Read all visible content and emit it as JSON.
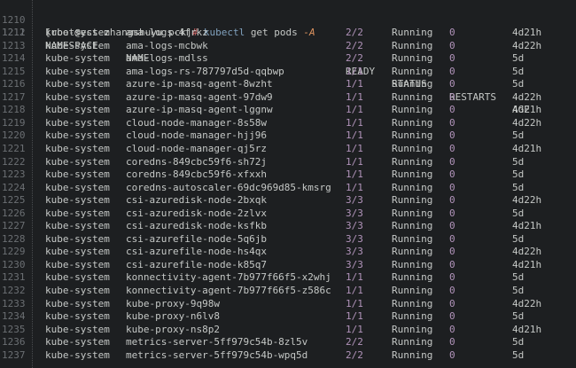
{
  "prompt": {
    "line_no": "1210",
    "open_bracket": "[",
    "user_host": "root@ecs-zhangshuyu pck",
    "close_bracket": "]",
    "hash": "#",
    "command": "kubectl",
    "args": "get pods",
    "flag": "-A"
  },
  "header": {
    "line_no": "1211",
    "namespace": "NAMESPACE",
    "name": "NAME",
    "ready": "READY",
    "status": "STATUS",
    "restarts": "RESTARTS",
    "age": "AGE"
  },
  "colors": {
    "background": "#1d1f21",
    "text": "#c5c8c6",
    "line_number": "#6b6f73",
    "ready_restarts": "#b294bb",
    "command": "#81a2be",
    "flag": "#de935f",
    "prompt_hash": "#cc6666"
  },
  "rows": [
    {
      "ln": "1212",
      "ns": "kube-system",
      "name": "ama-logs-4frkz",
      "ready": "2/2",
      "status": "Running",
      "restarts": "0",
      "age": "4d21h"
    },
    {
      "ln": "1213",
      "ns": "kube-system",
      "name": "ama-logs-mcbwk",
      "ready": "2/2",
      "status": "Running",
      "restarts": "0",
      "age": "4d22h"
    },
    {
      "ln": "1214",
      "ns": "kube-system",
      "name": "ama-logs-mdlss",
      "ready": "2/2",
      "status": "Running",
      "restarts": "0",
      "age": "5d"
    },
    {
      "ln": "1215",
      "ns": "kube-system",
      "name": "ama-logs-rs-787797d5d-qqbwp",
      "ready": "1/1",
      "status": "Running",
      "restarts": "0",
      "age": "5d"
    },
    {
      "ln": "1216",
      "ns": "kube-system",
      "name": "azure-ip-masq-agent-8wzht",
      "ready": "1/1",
      "status": "Running",
      "restarts": "0",
      "age": "5d"
    },
    {
      "ln": "1217",
      "ns": "kube-system",
      "name": "azure-ip-masq-agent-97dw9",
      "ready": "1/1",
      "status": "Running",
      "restarts": "0",
      "age": "4d22h"
    },
    {
      "ln": "1218",
      "ns": "kube-system",
      "name": "azure-ip-masq-agent-lggnw",
      "ready": "1/1",
      "status": "Running",
      "restarts": "0",
      "age": "4d21h"
    },
    {
      "ln": "1219",
      "ns": "kube-system",
      "name": "cloud-node-manager-8s58w",
      "ready": "1/1",
      "status": "Running",
      "restarts": "0",
      "age": "4d22h"
    },
    {
      "ln": "1220",
      "ns": "kube-system",
      "name": "cloud-node-manager-hjj96",
      "ready": "1/1",
      "status": "Running",
      "restarts": "0",
      "age": "5d"
    },
    {
      "ln": "1221",
      "ns": "kube-system",
      "name": "cloud-node-manager-qj5rz",
      "ready": "1/1",
      "status": "Running",
      "restarts": "0",
      "age": "4d21h"
    },
    {
      "ln": "1222",
      "ns": "kube-system",
      "name": "coredns-849cbc59f6-sh72j",
      "ready": "1/1",
      "status": "Running",
      "restarts": "0",
      "age": "5d"
    },
    {
      "ln": "1223",
      "ns": "kube-system",
      "name": "coredns-849cbc59f6-xfxxh",
      "ready": "1/1",
      "status": "Running",
      "restarts": "0",
      "age": "5d"
    },
    {
      "ln": "1224",
      "ns": "kube-system",
      "name": "coredns-autoscaler-69dc969d85-kmsrg",
      "ready": "1/1",
      "status": "Running",
      "restarts": "0",
      "age": "5d"
    },
    {
      "ln": "1225",
      "ns": "kube-system",
      "name": "csi-azuredisk-node-2bxqk",
      "ready": "3/3",
      "status": "Running",
      "restarts": "0",
      "age": "4d22h"
    },
    {
      "ln": "1226",
      "ns": "kube-system",
      "name": "csi-azuredisk-node-2zlvx",
      "ready": "3/3",
      "status": "Running",
      "restarts": "0",
      "age": "5d"
    },
    {
      "ln": "1227",
      "ns": "kube-system",
      "name": "csi-azuredisk-node-ksfkb",
      "ready": "3/3",
      "status": "Running",
      "restarts": "0",
      "age": "4d21h"
    },
    {
      "ln": "1228",
      "ns": "kube-system",
      "name": "csi-azurefile-node-5q6jb",
      "ready": "3/3",
      "status": "Running",
      "restarts": "0",
      "age": "5d"
    },
    {
      "ln": "1229",
      "ns": "kube-system",
      "name": "csi-azurefile-node-hs4qx",
      "ready": "3/3",
      "status": "Running",
      "restarts": "0",
      "age": "4d22h"
    },
    {
      "ln": "1230",
      "ns": "kube-system",
      "name": "csi-azurefile-node-k85q7",
      "ready": "3/3",
      "status": "Running",
      "restarts": "0",
      "age": "4d21h"
    },
    {
      "ln": "1231",
      "ns": "kube-system",
      "name": "konnectivity-agent-7b977f66f5-x2whj",
      "ready": "1/1",
      "status": "Running",
      "restarts": "0",
      "age": "5d"
    },
    {
      "ln": "1232",
      "ns": "kube-system",
      "name": "konnectivity-agent-7b977f66f5-z586c",
      "ready": "1/1",
      "status": "Running",
      "restarts": "0",
      "age": "5d"
    },
    {
      "ln": "1233",
      "ns": "kube-system",
      "name": "kube-proxy-9q98w",
      "ready": "1/1",
      "status": "Running",
      "restarts": "0",
      "age": "4d22h"
    },
    {
      "ln": "1234",
      "ns": "kube-system",
      "name": "kube-proxy-n6lv8",
      "ready": "1/1",
      "status": "Running",
      "restarts": "0",
      "age": "5d"
    },
    {
      "ln": "1235",
      "ns": "kube-system",
      "name": "kube-proxy-ns8p2",
      "ready": "1/1",
      "status": "Running",
      "restarts": "0",
      "age": "4d21h"
    },
    {
      "ln": "1236",
      "ns": "kube-system",
      "name": "metrics-server-5ff979c54b-8zl5v",
      "ready": "2/2",
      "status": "Running",
      "restarts": "0",
      "age": "5d"
    },
    {
      "ln": "1237",
      "ns": "kube-system",
      "name": "metrics-server-5ff979c54b-wpq5d",
      "ready": "2/2",
      "status": "Running",
      "restarts": "0",
      "age": "5d"
    }
  ]
}
